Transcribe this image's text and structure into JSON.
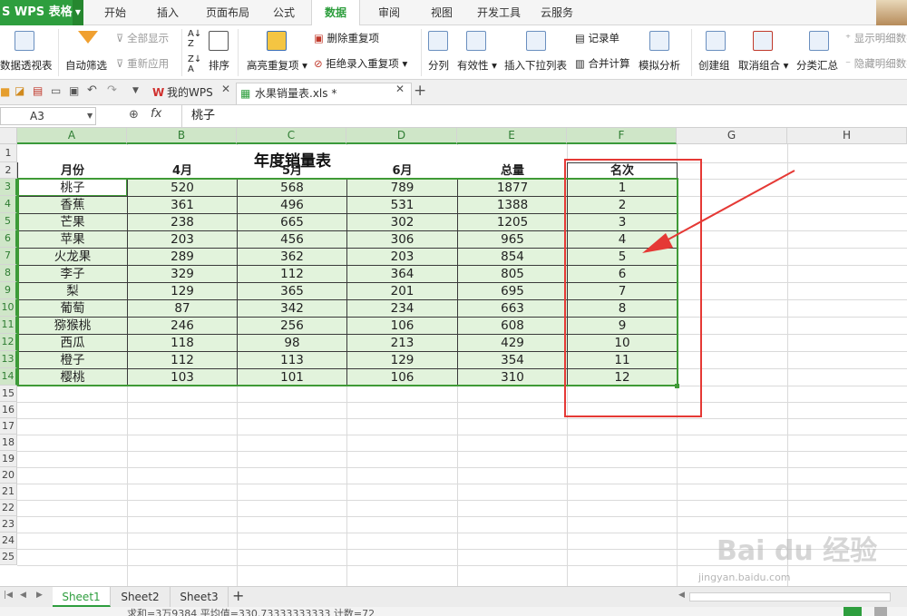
{
  "app": {
    "name": "WPS 表格"
  },
  "ribbon_tabs": [
    "开始",
    "插入",
    "页面布局",
    "公式",
    "数据",
    "审阅",
    "视图",
    "开发工具",
    "云服务"
  ],
  "active_ribbon_tab": "数据",
  "toolbar": {
    "pivot": "数据透视表",
    "autofilter": "自动筛选",
    "show_all": "全部显示",
    "reapply": "重新应用",
    "sort": "排序",
    "highlight_dup": "高亮重复项",
    "remove_dup": "删除重复项",
    "reject_dup": "拒绝录入重复项",
    "split": "分列",
    "validity": "有效性",
    "insert_dropdown": "插入下拉列表",
    "record": "记录单",
    "merge_calc": "合并计算",
    "simulate": "模拟分析",
    "create_group": "创建组",
    "ungroup": "取消组合",
    "subtotal": "分类汇总",
    "show_detail": "显示明细数据",
    "hide_detail": "隐藏明细数据"
  },
  "doc_tabs": [
    {
      "label": "我的WPS"
    },
    {
      "label": "水果销量表.xls *"
    }
  ],
  "formula_bar": {
    "cell_ref": "A3",
    "fx": "fx",
    "value": "桃子"
  },
  "columns": [
    "A",
    "B",
    "C",
    "D",
    "E",
    "F",
    "G",
    "H"
  ],
  "rows": [
    "1",
    "2",
    "3",
    "4",
    "5",
    "6",
    "7",
    "8",
    "9",
    "10",
    "11",
    "12",
    "13",
    "14",
    "15",
    "16",
    "17",
    "18",
    "19",
    "20",
    "21",
    "22",
    "23",
    "24",
    "25"
  ],
  "sheet": {
    "title": "年度销量表",
    "headers": [
      "月份",
      "4月",
      "5月",
      "6月",
      "总量",
      "名次"
    ],
    "data": [
      [
        "桃子",
        "520",
        "568",
        "789",
        "1877",
        "1"
      ],
      [
        "香蕉",
        "361",
        "496",
        "531",
        "1388",
        "2"
      ],
      [
        "芒果",
        "238",
        "665",
        "302",
        "1205",
        "3"
      ],
      [
        "苹果",
        "203",
        "456",
        "306",
        "965",
        "4"
      ],
      [
        "火龙果",
        "289",
        "362",
        "203",
        "854",
        "5"
      ],
      [
        "李子",
        "329",
        "112",
        "364",
        "805",
        "6"
      ],
      [
        "梨",
        "129",
        "365",
        "201",
        "695",
        "7"
      ],
      [
        "葡萄",
        "87",
        "342",
        "234",
        "663",
        "8"
      ],
      [
        "猕猴桃",
        "246",
        "256",
        "106",
        "608",
        "9"
      ],
      [
        "西瓜",
        "118",
        "98",
        "213",
        "429",
        "10"
      ],
      [
        "橙子",
        "112",
        "113",
        "129",
        "354",
        "11"
      ],
      [
        "樱桃",
        "103",
        "101",
        "106",
        "310",
        "12"
      ]
    ]
  },
  "sheet_tabs": [
    "Sheet1",
    "Sheet2",
    "Sheet3"
  ],
  "active_sheet": "Sheet1",
  "status": {
    "text": "求和=3万9384  平均值=330.73333333333  计数=72"
  },
  "watermark": {
    "text": "Bai du 经验",
    "sub": "jingyan.baidu.com"
  },
  "colors": {
    "accent": "#2e9e3e",
    "selection": "#e2f3dc",
    "annotation": "#e53935"
  }
}
